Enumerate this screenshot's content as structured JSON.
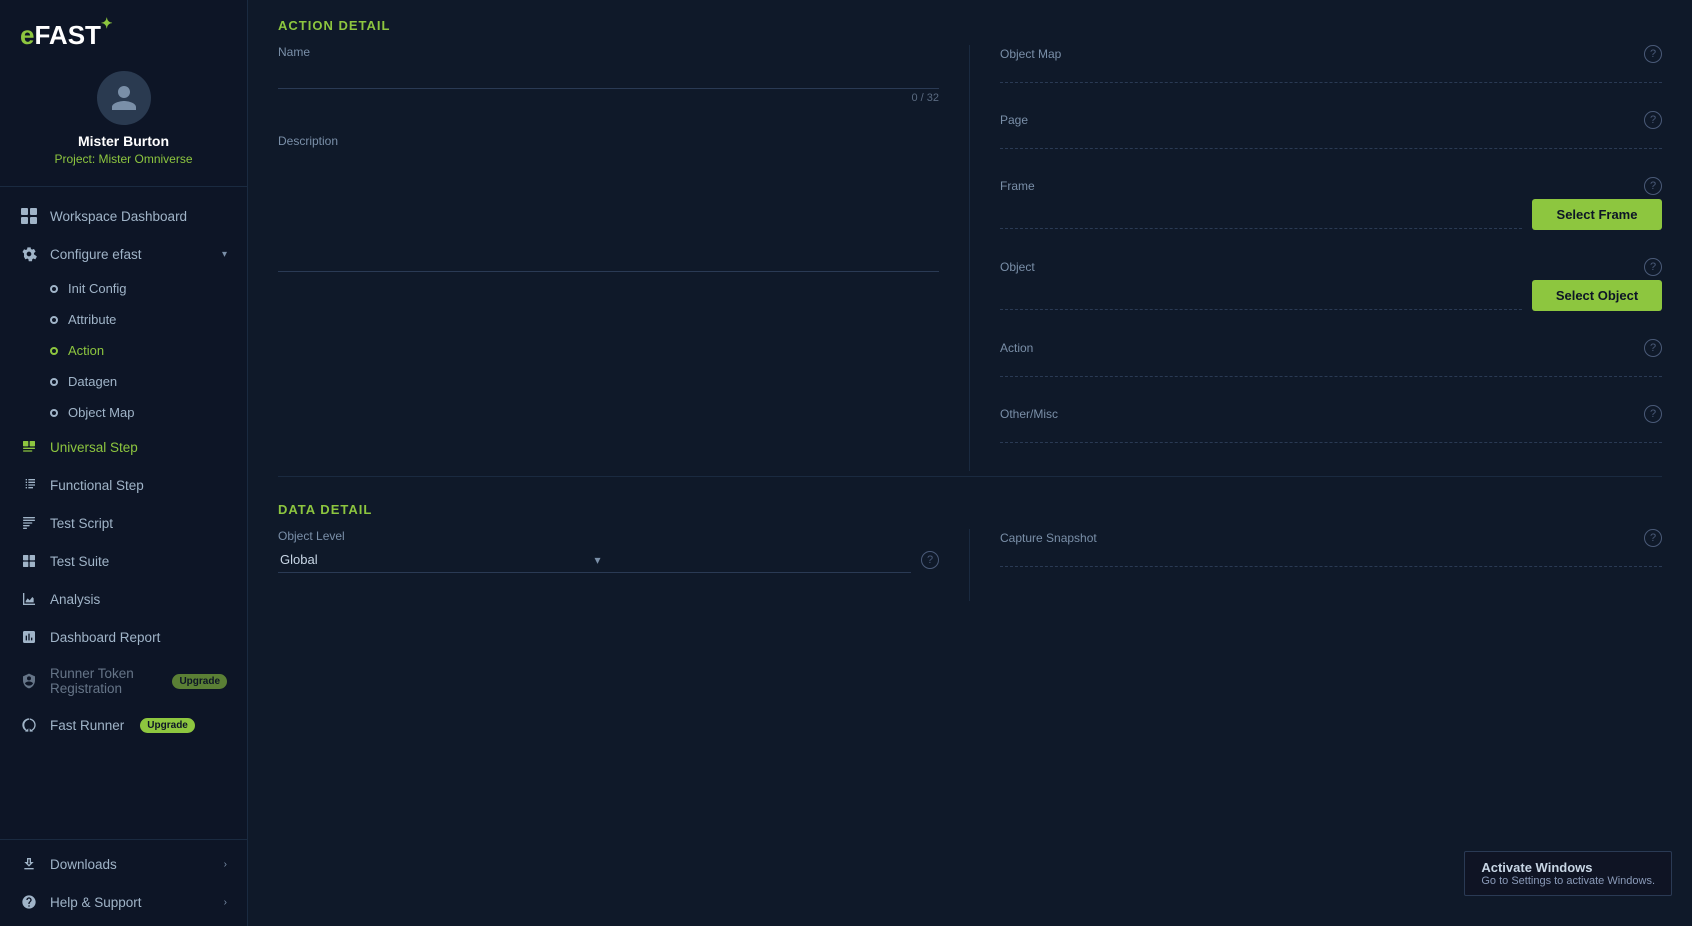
{
  "sidebar": {
    "logo": "eFAST",
    "logo_badge": "✓",
    "user": {
      "name": "Mister Burton",
      "project": "Project: Mister Omniverse"
    },
    "nav_items": [
      {
        "id": "workspace-dashboard",
        "label": "Workspace Dashboard",
        "icon": "grid-icon",
        "active": false
      },
      {
        "id": "configure-efast",
        "label": "Configure efast",
        "icon": "gear-icon",
        "active": false,
        "expandable": true
      },
      {
        "id": "init-config",
        "label": "Init Config",
        "icon": "dot-icon",
        "sub": true,
        "active": false
      },
      {
        "id": "attribute",
        "label": "Attribute",
        "icon": "dot-icon",
        "sub": true,
        "active": false
      },
      {
        "id": "action",
        "label": "Action",
        "icon": "dot-icon",
        "sub": true,
        "active": true
      },
      {
        "id": "datagen",
        "label": "Datagen",
        "icon": "dot-icon",
        "sub": true,
        "active": false
      },
      {
        "id": "object-map",
        "label": "Object Map",
        "icon": "dot-icon",
        "sub": true,
        "active": false
      },
      {
        "id": "universal-step",
        "label": "Universal Step",
        "icon": "universal-icon",
        "active": true
      },
      {
        "id": "functional-step",
        "label": "Functional Step",
        "icon": "functional-icon",
        "active": false
      },
      {
        "id": "test-script",
        "label": "Test Script",
        "icon": "script-icon",
        "active": false
      },
      {
        "id": "test-suite",
        "label": "Test Suite",
        "icon": "suite-icon",
        "active": false
      },
      {
        "id": "analysis",
        "label": "Analysis",
        "icon": "analysis-icon",
        "active": false
      },
      {
        "id": "dashboard-report",
        "label": "Dashboard Report",
        "icon": "report-icon",
        "active": false
      },
      {
        "id": "runner-token",
        "label": "Runner Token Registration",
        "icon": "token-icon",
        "active": false,
        "badge": "Upgrade"
      },
      {
        "id": "fast-runner",
        "label": "Fast Runner",
        "icon": "runner-icon",
        "active": false,
        "badge": "Upgrade"
      }
    ],
    "bottom_items": [
      {
        "id": "downloads",
        "label": "Downloads",
        "icon": "download-icon",
        "expandable": true
      },
      {
        "id": "help-support",
        "label": "Help & Support",
        "icon": "help-icon",
        "expandable": true
      }
    ]
  },
  "main": {
    "action_detail": {
      "section_title": "ACTION DETAIL",
      "name_label": "Name",
      "name_value": "",
      "name_char_count": "0 / 32",
      "description_label": "Description",
      "description_value": "",
      "object_map_label": "Object Map",
      "object_map_value": "",
      "page_label": "Page",
      "page_value": "",
      "frame_label": "Frame",
      "frame_value": "",
      "select_frame_btn": "Select Frame",
      "object_label": "Object",
      "object_value": "",
      "select_object_btn": "Select Object",
      "action_label": "Action",
      "action_value": "",
      "other_misc_label": "Other/Misc",
      "other_misc_value": ""
    },
    "data_detail": {
      "section_title": "DATA DETAIL",
      "object_level_label": "Object Level",
      "object_level_value": "Global",
      "capture_snapshot_label": "Capture Snapshot",
      "capture_snapshot_value": ""
    },
    "windows_activate": {
      "title": "Activate Windows",
      "message": "Go to Settings to activate Windows."
    }
  }
}
